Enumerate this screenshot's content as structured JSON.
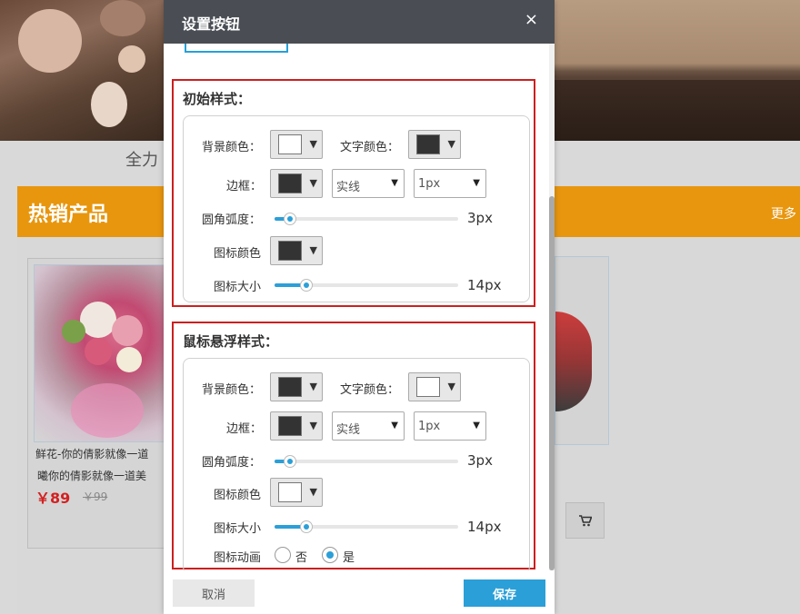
{
  "background": {
    "slogan": "全力",
    "hot_title": "热销产品",
    "hot_more": "更多",
    "product": {
      "name_line1": "鲜花-你的倩影就像一道",
      "name_line2": "曦你的倩影就像一道美",
      "price": "￥89",
      "old_price": "￥99"
    }
  },
  "modal": {
    "title": "设置按钮",
    "close_icon": "×",
    "initial": {
      "title": "初始样式：",
      "bg_color_label": "背景颜色：",
      "bg_color": "#ffffff",
      "text_color_label": "文字颜色：",
      "text_color": "#333333",
      "border_label": "边框：",
      "border_color": "#333333",
      "border_style": "实线",
      "border_width": "1px",
      "radius_label": "圆角弧度：",
      "radius_value": "3px",
      "radius_level": 0.05,
      "icon_color_label": "图标颜色",
      "icon_color": "#333333",
      "icon_size_label": "图标大小",
      "icon_size_value": "14px",
      "icon_size_level": 0.14
    },
    "hover": {
      "title": "鼠标悬浮样式：",
      "bg_color_label": "背景颜色：",
      "bg_color": "#333333",
      "text_color_label": "文字颜色：",
      "text_color": "#ffffff",
      "border_label": "边框：",
      "border_color": "#333333",
      "border_style": "实线",
      "border_width": "1px",
      "radius_label": "圆角弧度：",
      "radius_value": "3px",
      "radius_level": 0.05,
      "icon_color_label": "图标颜色",
      "icon_color": "#ffffff",
      "icon_size_label": "图标大小",
      "icon_size_value": "14px",
      "icon_size_level": 0.14,
      "anim_label": "图标动画",
      "anim_no": "否",
      "anim_yes": "是",
      "anim_selected": "是"
    },
    "cancel_label": "取消",
    "save_label": "保存"
  },
  "colors": {
    "accent": "#2b9fd8",
    "highlight_border": "#cc1f1f",
    "header": "#4a4e54",
    "hot_bar": "#e8960e",
    "price": "#d32121"
  },
  "icons": [
    "close-icon",
    "dropdown-arrow-icon",
    "cart-icon",
    "scrollbar"
  ]
}
